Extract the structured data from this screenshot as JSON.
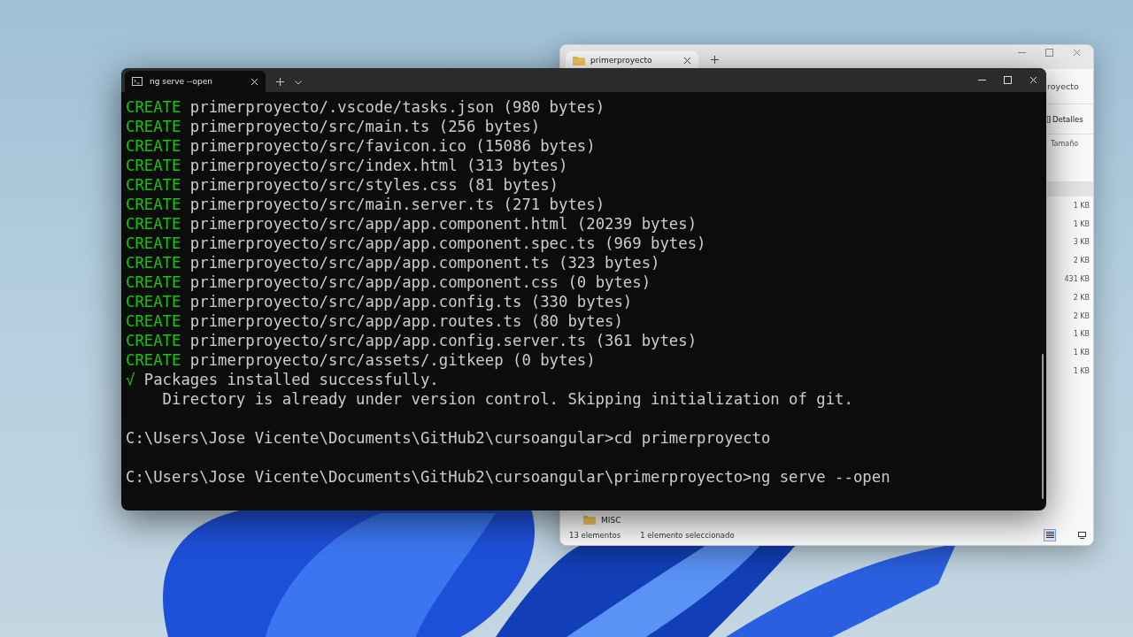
{
  "explorer": {
    "tab_title": "primerproyecto",
    "address_partial": "royecto",
    "view_button": "Detalles",
    "column": "Tamaño",
    "sizes": [
      "1 KB",
      "1 KB",
      "3 KB",
      "2 KB",
      "431 KB",
      "2 KB",
      "2 KB",
      "1 KB",
      "1 KB",
      "1 KB"
    ],
    "folder": "MISC",
    "status": {
      "count": "13 elementos",
      "selection": "1 elemento seleccionado"
    },
    "view_modes": [
      {
        "kind": "details",
        "selected": true
      },
      {
        "kind": "tiles",
        "selected": false
      }
    ]
  },
  "terminal": {
    "tab_title": "ng serve --open",
    "lines": [
      {
        "kind": "create",
        "tag": "CREATE",
        "text": "primerproyecto/.vscode/tasks.json (980 bytes)"
      },
      {
        "kind": "create",
        "tag": "CREATE",
        "text": "primerproyecto/src/main.ts (256 bytes)"
      },
      {
        "kind": "create",
        "tag": "CREATE",
        "text": "primerproyecto/src/favicon.ico (15086 bytes)"
      },
      {
        "kind": "create",
        "tag": "CREATE",
        "text": "primerproyecto/src/index.html (313 bytes)"
      },
      {
        "kind": "create",
        "tag": "CREATE",
        "text": "primerproyecto/src/styles.css (81 bytes)"
      },
      {
        "kind": "create",
        "tag": "CREATE",
        "text": "primerproyecto/src/main.server.ts (271 bytes)"
      },
      {
        "kind": "create",
        "tag": "CREATE",
        "text": "primerproyecto/src/app/app.component.html (20239 bytes)"
      },
      {
        "kind": "create",
        "tag": "CREATE",
        "text": "primerproyecto/src/app/app.component.spec.ts (969 bytes)"
      },
      {
        "kind": "create",
        "tag": "CREATE",
        "text": "primerproyecto/src/app/app.component.ts (323 bytes)"
      },
      {
        "kind": "create",
        "tag": "CREATE",
        "text": "primerproyecto/src/app/app.component.css (0 bytes)"
      },
      {
        "kind": "create",
        "tag": "CREATE",
        "text": "primerproyecto/src/app/app.config.ts (330 bytes)"
      },
      {
        "kind": "create",
        "tag": "CREATE",
        "text": "primerproyecto/src/app/app.routes.ts (80 bytes)"
      },
      {
        "kind": "create",
        "tag": "CREATE",
        "text": "primerproyecto/src/app/app.config.server.ts (361 bytes)"
      },
      {
        "kind": "create",
        "tag": "CREATE",
        "text": "primerproyecto/src/assets/.gitkeep (0 bytes)"
      },
      {
        "kind": "success",
        "tag": "√",
        "text": "Packages installed successfully."
      },
      {
        "kind": "plain",
        "text": "    Directory is already under version control. Skipping initialization of git."
      },
      {
        "kind": "blank"
      },
      {
        "kind": "plain",
        "text": "C:\\Users\\Jose Vicente\\Documents\\GitHub2\\cursoangular>cd primerproyecto"
      },
      {
        "kind": "blank"
      },
      {
        "kind": "plain",
        "text": "C:\\Users\\Jose Vicente\\Documents\\GitHub2\\cursoangular\\primerproyecto>ng serve --open"
      }
    ]
  }
}
